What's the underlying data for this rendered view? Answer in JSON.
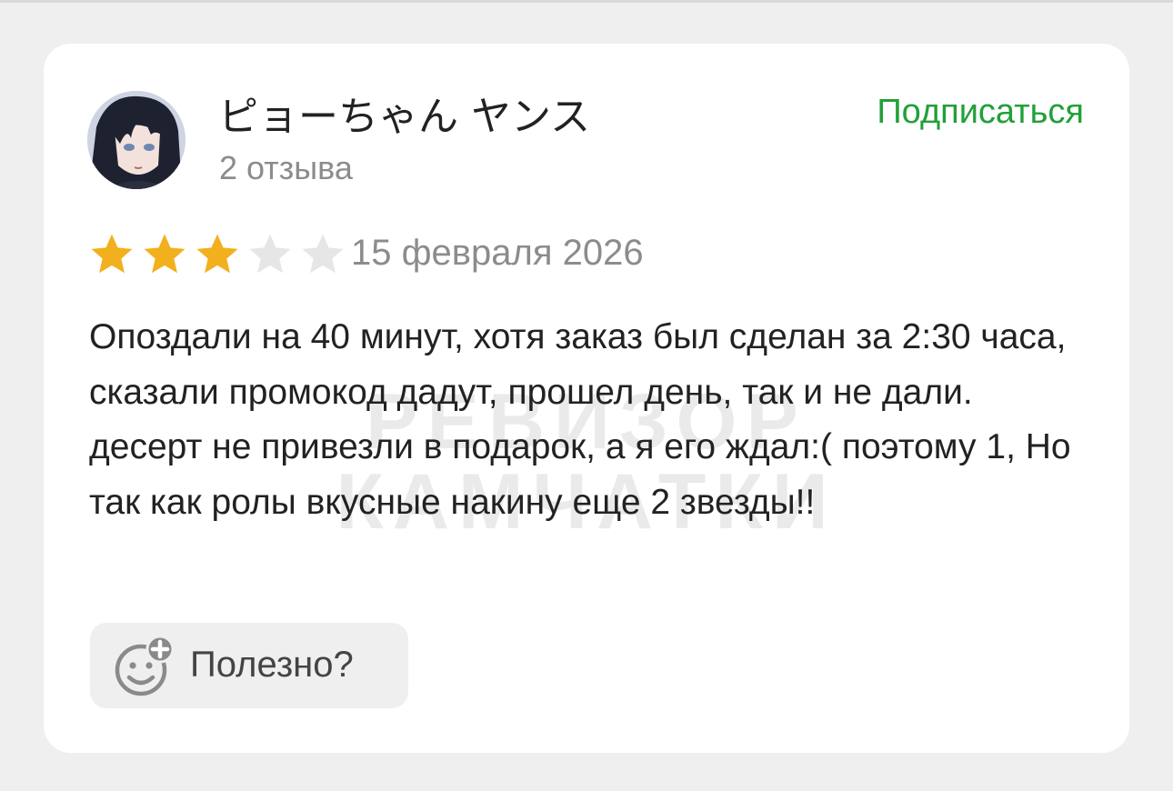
{
  "review": {
    "author": {
      "name": "ピョーちゃん ヤンス",
      "review_count": "2 отзыва",
      "avatar": "anime-avatar"
    },
    "subscribe_label": "Подписаться",
    "rating": {
      "value": 3,
      "max": 5,
      "filled_color": "#f2b01e",
      "empty_color": "#e6e6e6"
    },
    "date": "15 февраля 2026",
    "text": "Опоздали на 40 минут, хотя заказ был сделан за 2:30 часа, сказали промокод дадут, прошел день, так и не дали. десерт не привезли в подарок, а я его ждал:( поэтому 1, Но так как ролы вкусные накину еще 2 звезды!!",
    "helpful": {
      "label": "Полезно?",
      "icon": "smiley-plus-icon"
    }
  },
  "watermark": {
    "line1": "РЕВИЗОР",
    "line2": "КАМЧАТКИ"
  },
  "colors": {
    "accent": "#21a038",
    "page_background": "#efefef",
    "card_background": "#ffffff"
  }
}
